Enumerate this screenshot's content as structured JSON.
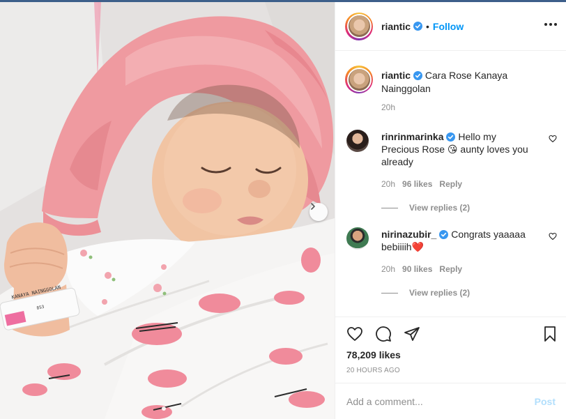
{
  "post": {
    "author": "riantic",
    "follow_label": "Follow",
    "separator": "•",
    "caption_author": "riantic",
    "caption_text": "Cara Rose Kanaya Nainggolan",
    "caption_time": "20h",
    "comments": [
      {
        "username": "rinrinmarinka",
        "text": "Hello my Precious Rose 😘 aunty loves you already",
        "time": "20h",
        "likes": "96 likes",
        "reply_label": "Reply",
        "view_replies": "View replies (2)"
      },
      {
        "username": "nirinazubir_",
        "text": "Congrats yaaaaa bebiiiih❤️",
        "time": "20h",
        "likes": "90 likes",
        "reply_label": "Reply",
        "view_replies": "View replies (2)"
      }
    ],
    "like_count": "78,209 likes",
    "posted_ago": "20 HOURS AGO",
    "comment_placeholder": "Add a comment...",
    "post_label": "Post",
    "wristband_text": "KANAYA NAINGGOLAN",
    "wristband_sub": "853"
  },
  "colors": {
    "follow_blue": "#0095f6",
    "verified_blue": "#3897f0",
    "muted_text": "#8e8e8e",
    "post_disabled": "#b2dffc",
    "hat_pink": "#ef9a9f"
  },
  "icons": [
    "verified-badge-icon",
    "more-options-icon",
    "heart-icon",
    "comment-icon",
    "share-icon",
    "bookmark-icon",
    "next-arrow-icon"
  ]
}
